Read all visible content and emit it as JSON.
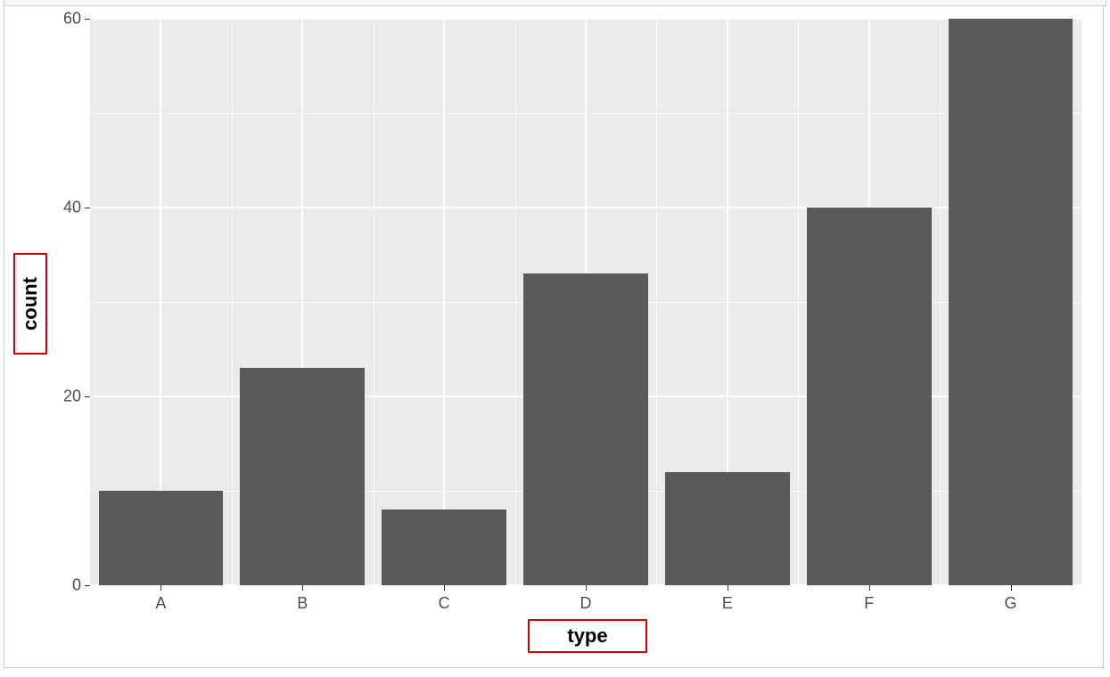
{
  "chart_data": {
    "type": "bar",
    "categories": [
      "A",
      "B",
      "C",
      "D",
      "E",
      "F",
      "G"
    ],
    "values": [
      10,
      23,
      8,
      33,
      12,
      40,
      60
    ],
    "xlabel": "type",
    "ylabel": "count",
    "ylim": [
      0,
      60
    ],
    "y_ticks": [
      0,
      20,
      40,
      60
    ],
    "title": ""
  },
  "axis": {
    "y0": "0",
    "y20": "20",
    "y40": "40",
    "y60": "60",
    "xA": "A",
    "xB": "B",
    "xC": "C",
    "xD": "D",
    "xE": "E",
    "xF": "F",
    "xG": "G",
    "ytitle": "count",
    "xtitle": "type"
  }
}
